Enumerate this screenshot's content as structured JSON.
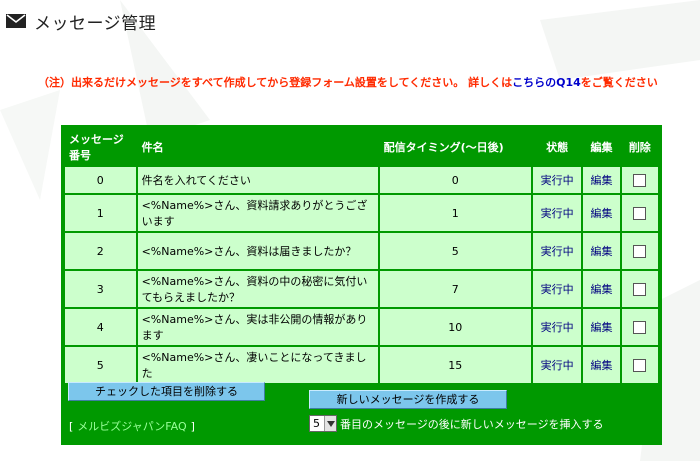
{
  "page": {
    "title": "メッセージ管理",
    "icon": "mail-icon"
  },
  "notice": {
    "text": "（注）出来るだけメッセージをすべて作成してから登録フォーム設置をしてください。",
    "link_prefix": "詳しくは",
    "link": "こちらのQ14",
    "suffix": "をご覧ください"
  },
  "table": {
    "headers": {
      "number": "メッセージ番号",
      "subject": "件名",
      "timing": "配信タイミング(～日後)",
      "status": "状態",
      "edit": "編集",
      "delete": "削除"
    },
    "rows": [
      {
        "number": "0",
        "subject": "件名を入れてください",
        "timing": "0",
        "status": "実行中",
        "edit": "編集",
        "checked": false
      },
      {
        "number": "1",
        "subject": "<%Name%>さん、資料請求ありがとうございます",
        "timing": "1",
        "status": "実行中",
        "edit": "編集",
        "checked": false
      },
      {
        "number": "2",
        "subject": "<%Name%>さん、資料は届きましたか？",
        "timing": "5",
        "status": "実行中",
        "edit": "編集",
        "checked": false
      },
      {
        "number": "3",
        "subject": "<%Name%>さん、資料の中の秘密に気付いてもらえましたか？",
        "timing": "7",
        "status": "実行中",
        "edit": "編集",
        "checked": false
      },
      {
        "number": "4",
        "subject": "<%Name%>さん、実は非公開の情報があります",
        "timing": "10",
        "status": "実行中",
        "edit": "編集",
        "checked": false
      },
      {
        "number": "5",
        "subject": "<%Name%>さん、凄いことになってきました",
        "timing": "15",
        "status": "実行中",
        "edit": "編集",
        "checked": false
      }
    ]
  },
  "actions": {
    "delete_checked": "チェックした項目を削除する",
    "new_message": "新しいメッセージを作成する",
    "insert_select_value": "5",
    "insert_text": "番目のメッセージの後に新しいメッセージを挿入する",
    "faq_link": "メルビズジャパンFAQ",
    "faq_open": "[",
    "faq_close": "]"
  },
  "colors": {
    "panel": "#009900",
    "row": "#ccffcc",
    "button": "#7cc6ec",
    "notice": "#ff2a00",
    "link": "#0000cc"
  }
}
